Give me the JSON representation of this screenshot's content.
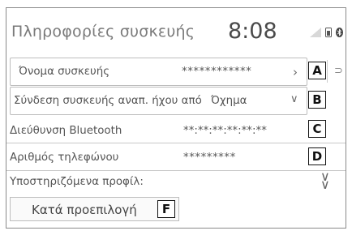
{
  "header": {
    "title": "Πληροφορίες συσκευής",
    "clock": "8:08"
  },
  "rows": [
    {
      "label": "Όνομα συσκευής",
      "value": "************",
      "badge": "A"
    },
    {
      "label": "Σύνδεση συσκευής αναπ. ήχου από",
      "value": "Όχημα",
      "badge": "B"
    },
    {
      "label": "Διεύθυνση Bluetooth",
      "value": "**:**:**:**:**:**",
      "badge": "C"
    },
    {
      "label": "Αριθμός τηλεφώνου",
      "value": "*********",
      "badge": "D"
    }
  ],
  "profiles": {
    "label": "Υποστηριζόμενα προφίλ:"
  },
  "default_button": {
    "label": "Κατά προεπιλογή",
    "badge": "F"
  },
  "icons": {
    "signal": "signal-bars-icon",
    "phone": "phone-battery-icon",
    "bluetooth": "bluetooth-icon",
    "chevron_right": "chevron-right-icon",
    "chevron_down": "chevron-down-icon",
    "double_chevron_down": "double-chevron-down-icon"
  }
}
